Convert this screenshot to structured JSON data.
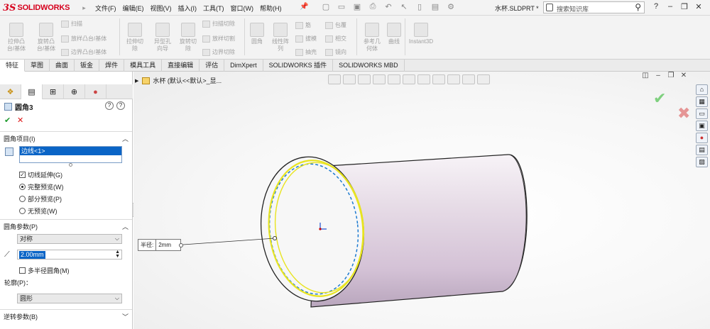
{
  "app": {
    "logo_ds": "3S",
    "logo_text": "SOLIDWORKS",
    "menu": [
      "文件(F)",
      "编辑(E)",
      "视图(V)",
      "插入(I)",
      "工具(T)",
      "窗口(W)",
      "帮助(H)"
    ],
    "filename": "水杯.SLDPRT *",
    "search_placeholder": "搜索知识库",
    "help_glyph": "?"
  },
  "ribbon": {
    "extrude_boss": "拉伸凸\n台/基体",
    "revolve_boss": "旋转凸\n台/基体",
    "sweep": "扫描",
    "loft_boss": "放样凸台/基体",
    "boundary_boss": "边界凸台/基体",
    "extrude_cut": "拉伸切\n除",
    "hole_wizard": "异型孔\n向导",
    "revolve_cut": "旋转切\n除",
    "sweep_cut": "扫描切除",
    "loft_cut": "放样切割",
    "boundary_cut": "边界切除",
    "fillet": "圆角",
    "linear_pattern": "线性阵\n列",
    "rib": "筋",
    "draft": "拔模",
    "shell": "抽壳",
    "wrap": "包覆",
    "intersect": "相交",
    "mirror": "镜向",
    "ref_geometry": "参考几\n何体",
    "curves": "曲线",
    "instant3d": "Instant3D"
  },
  "tabs": [
    "特征",
    "草图",
    "曲面",
    "钣金",
    "焊件",
    "模具工具",
    "直接编辑",
    "评估",
    "DimXpert",
    "SOLIDWORKS 插件",
    "SOLIDWORKS MBD"
  ],
  "tree": {
    "label": "水杯 (默认<<默认>_显..."
  },
  "pm": {
    "title": "圆角3",
    "ok": "✔",
    "cancel": "✕",
    "items_section": "圆角项目(I)",
    "selected_edge": "边线<1>",
    "tangent_propagation": "切线延伸(G)",
    "full_preview": "完整预览(W)",
    "partial_preview": "部分预览(P)",
    "no_preview": "无预览(W)",
    "params_section": "圆角参数(P)",
    "symmetric": "对称",
    "radius_value": "2.00mm",
    "multi_radius": "多半径圆角(M)",
    "profile_label": "轮廓(P)：",
    "profile_value": "圆形",
    "reverse_section": "逆转参数(B)"
  },
  "callout": {
    "label": "半径:",
    "value": "2mm"
  }
}
